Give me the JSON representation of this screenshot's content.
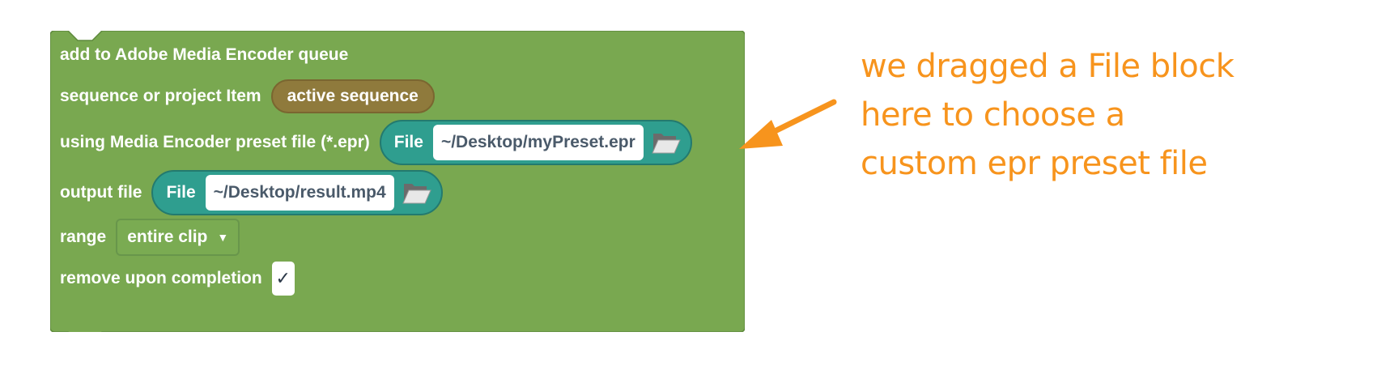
{
  "block": {
    "title": "add to Adobe Media Encoder queue",
    "sequence": {
      "label": "sequence or project Item",
      "value": "active sequence"
    },
    "preset": {
      "label": "using Media Encoder preset file (*.epr)",
      "file_tag": "File",
      "path": "~/Desktop/myPreset.epr",
      "icon": "folder-icon"
    },
    "output": {
      "label": "output file",
      "file_tag": "File",
      "path": "~/Desktop/result.mp4",
      "icon": "folder-icon"
    },
    "range": {
      "label": "range",
      "value": "entire clip",
      "icon": "caret-down-icon"
    },
    "remove": {
      "label": "remove upon completion",
      "checked": true,
      "mark": "✓"
    }
  },
  "annotation": {
    "lines": [
      "we dragged a File block",
      "here to choose a",
      "custom epr preset file"
    ],
    "color": "#f7941d"
  },
  "colors": {
    "block_green": "#79a850",
    "file_teal": "#2f9e8f",
    "variable_brown": "#8f7a3c"
  }
}
